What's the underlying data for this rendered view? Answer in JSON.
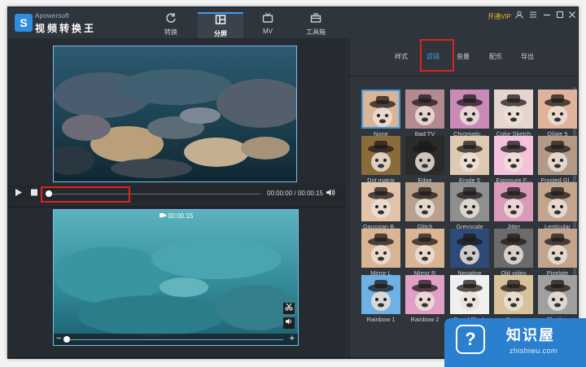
{
  "app": {
    "name_en": "Apowersoft",
    "name_cn": "视频转换王",
    "logo_glyph": "S"
  },
  "nav": {
    "tabs": [
      {
        "label": "转换",
        "icon": "refresh-icon"
      },
      {
        "label": "分屏",
        "icon": "split-screen-icon"
      },
      {
        "label": "MV",
        "icon": "tv-icon"
      },
      {
        "label": "工具箱",
        "icon": "toolbox-icon"
      }
    ],
    "active_index": 1
  },
  "titlebar": {
    "vip_label": "开通VIP",
    "icons": [
      "user-icon",
      "menu-icon",
      "minimize-icon",
      "maximize-icon",
      "close-icon"
    ]
  },
  "player": {
    "current_time": "00:00:00",
    "duration": "00:00:15",
    "time_separator": "/"
  },
  "clip": {
    "duration_label": "00:00:15",
    "trim_minus": "−",
    "trim_plus": "+"
  },
  "panel": {
    "tabs": [
      "样式",
      "滤镜",
      "音量",
      "配乐",
      "导出"
    ],
    "active_tab": "滤镜"
  },
  "filters": [
    {
      "label": "None",
      "selected": true
    },
    {
      "label": "Bad TV"
    },
    {
      "label": "Chromatic..."
    },
    {
      "label": "Color Sketch"
    },
    {
      "label": "Dilate 5"
    },
    {
      "label": "Dot matrix"
    },
    {
      "label": "Edge"
    },
    {
      "label": "Erode 5"
    },
    {
      "label": "Exposure F..."
    },
    {
      "label": "Frosted Gl..."
    },
    {
      "label": "Gaussian B..."
    },
    {
      "label": "Glitch"
    },
    {
      "label": "Greyscale"
    },
    {
      "label": "Jitter"
    },
    {
      "label": "Lenticular"
    },
    {
      "label": "Mirror L"
    },
    {
      "label": "Mirror R"
    },
    {
      "label": "Negative"
    },
    {
      "label": "Old video"
    },
    {
      "label": "Pixelate"
    },
    {
      "label": "Rainbow 1"
    },
    {
      "label": "Rainbow 2"
    },
    {
      "label": "Rapid Flash"
    },
    {
      "label": "Sepia"
    },
    {
      "label": "Shadow"
    }
  ],
  "watermark": {
    "icon_glyph": "?",
    "title": "知识屋",
    "url": "zhishiwu.com"
  },
  "colors": {
    "accent": "#3d9be9",
    "highlight_box": "#e02020",
    "vip": "#f0b429"
  }
}
